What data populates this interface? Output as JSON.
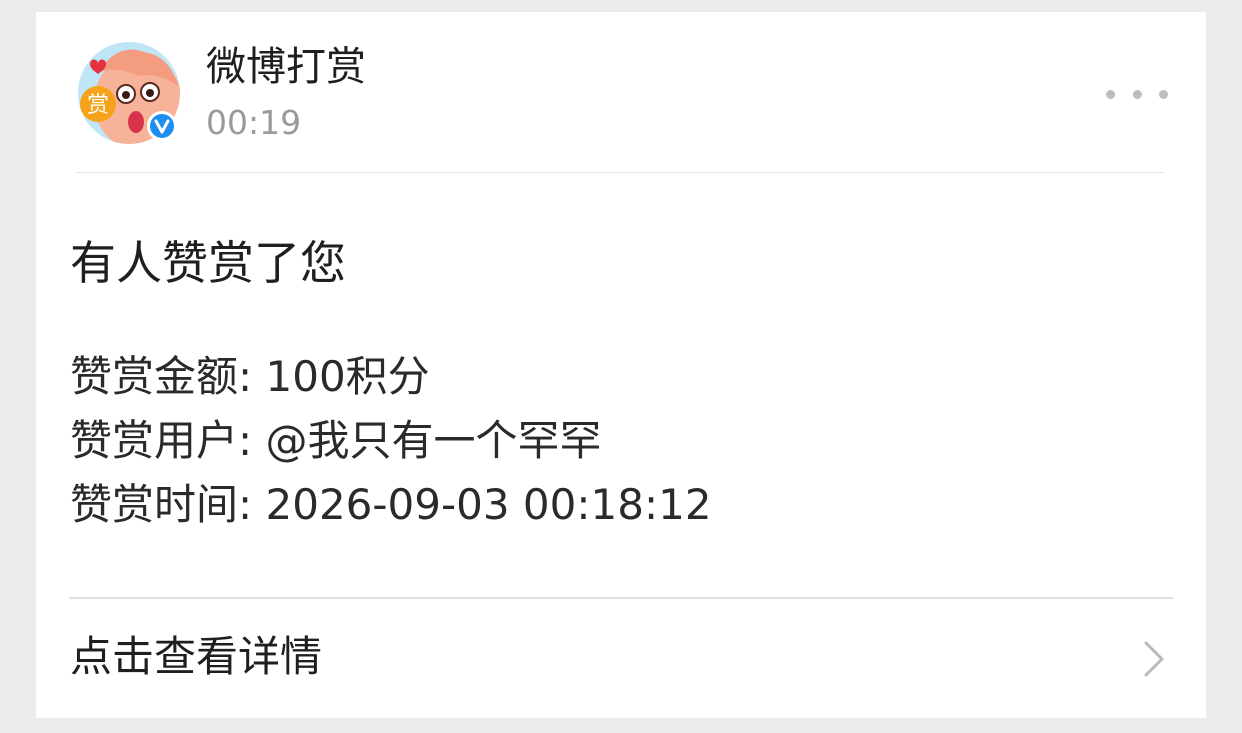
{
  "header": {
    "sender_name": "微博打赏",
    "time": "00:19",
    "avatar_badge_text": "赏"
  },
  "message": {
    "title": "有人赞赏了您",
    "details": [
      "赞赏金额: 100积分",
      "赞赏用户: @我只有一个罕罕",
      "赞赏时间: 2026-09-03 00:18:12"
    ]
  },
  "footer": {
    "view_details_label": "点击查看详情"
  },
  "icons": {
    "more": "more-horizontal-icon",
    "chevron": "chevron-right-icon",
    "verified": "verified-badge-icon"
  },
  "colors": {
    "background": "#ececec",
    "card": "#ffffff",
    "verified_blue": "#1e8ff0",
    "badge_orange": "#f6a21a",
    "muted_text": "#9a9a9a"
  }
}
